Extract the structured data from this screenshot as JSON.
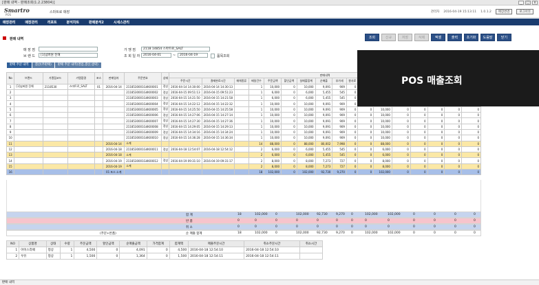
{
  "window": {
    "title": "[판매 내역 - 판매조회(1.2.23804)]",
    "controls": [
      "_",
      "□",
      "x"
    ]
  },
  "header": {
    "logo": "Smartro",
    "logo_sub": "POS",
    "shop": "스마트로 매장",
    "user": "관리자",
    "datetime": "2016-04-19 15:13:11",
    "version": "1.0.1.2",
    "btn_change": "매장변경",
    "btn_logout": "로그아웃"
  },
  "menu": [
    "매장관리",
    "매장관리",
    "리포트",
    "분석차트",
    "판매분석2",
    "시세스관리"
  ],
  "section_title": "판매 내역",
  "toolbar": [
    {
      "label": "조회",
      "enabled": true
    },
    {
      "label": "신규",
      "enabled": false
    },
    {
      "label": "저장",
      "enabled": false
    },
    {
      "label": "삭제",
      "enabled": false
    },
    {
      "label": "엑셀",
      "enabled": true
    },
    {
      "label": "출력",
      "enabled": true
    },
    {
      "label": "초기화",
      "enabled": true
    },
    {
      "label": "도움말",
      "enabled": true
    },
    {
      "label": "닫기",
      "enabled": true
    }
  ],
  "filters": {
    "store_label": "매 장 점",
    "store_value": "",
    "brand_label": "브 랜 드",
    "brand_value": "[1]넘버원 진해",
    "terminal_label": "가 맹 점",
    "terminal_value": "2118 14854 스마트로_SALT",
    "period_label": "조 회 일 자",
    "date_from": "2016-04-01",
    "date_sep": "~",
    "date_to": "2016-04-19",
    "check_label": "품목조회"
  },
  "tabs": [
    {
      "label": "판매 주문 내역",
      "active": true
    },
    {
      "label": "결산(주판매)",
      "active": false
    },
    {
      "label": "판매 주문 내역(영업,결산,생략)",
      "active": false
    }
  ],
  "overlay_text": "POS 매출조회",
  "grid": {
    "group_header": "판매내역",
    "headers": [
      "No",
      "브랜드",
      "가맹점코드",
      "가맹점명",
      "포스",
      "판매일자",
      "주문번호",
      "상태",
      "주문시간",
      "결제완료시간",
      "매체종류",
      "배달건수",
      "주문금액",
      "할인금액",
      "실매출합계",
      "순매출",
      "부가세",
      "봉사료",
      "면세금액",
      "지불금액",
      "카드",
      "현금",
      "포인트",
      "기타",
      "합계"
    ],
    "rows": [
      {
        "no": "1",
        "brand": "[1]넘버원 진해",
        "code": "2118530",
        "name": "스마트로_SALT",
        "pos": "01",
        "date": "2016-04-14",
        "order": "2118530001G4K00001",
        "status": "정상",
        "t1": "2016-04-14 14:30:00",
        "t2": "2016-04-14 14:30:13",
        "media": "",
        "cnt": "1",
        "amt": "10,000",
        "disc": "0",
        "sales": "10,000",
        "net": "9,091",
        "vat": "909",
        "svc": "0",
        "free": "0",
        "pay": "10,000",
        "card": "0",
        "cash": "0",
        "pt": "0",
        "etc": "0",
        "sum": "0",
        "type": "n"
      },
      {
        "no": "2",
        "brand": "",
        "code": "",
        "name": "",
        "pos": "",
        "date": "",
        "order": "2118530001G4K00002",
        "status": "정상",
        "t1": "2016-04-15 09:51:13",
        "t2": "2016-04-15 09:51:23",
        "media": "",
        "cnt": "1",
        "amt": "6,000",
        "disc": "0",
        "sales": "6,000",
        "net": "5,455",
        "vat": "545",
        "svc": "0",
        "free": "0",
        "pay": "6,000",
        "card": "0",
        "cash": "0",
        "pt": "0",
        "etc": "0",
        "sum": "0",
        "type": "n"
      },
      {
        "no": "3",
        "brand": "",
        "code": "",
        "name": "",
        "pos": "",
        "date": "",
        "order": "2118530001G4K00003",
        "status": "정상",
        "t1": "2016-04-15 14:21:50",
        "t2": "2016-04-15 14:21:58",
        "media": "",
        "cnt": "1",
        "amt": "6,000",
        "disc": "0",
        "sales": "6,000",
        "net": "5,455",
        "vat": "545",
        "svc": "0",
        "free": "0",
        "pay": "6,000",
        "card": "0",
        "cash": "0",
        "pt": "0",
        "etc": "0",
        "sum": "0",
        "type": "n"
      },
      {
        "no": "4",
        "brand": "",
        "code": "",
        "name": "",
        "pos": "",
        "date": "",
        "order": "2118530001G4K00004",
        "status": "정상",
        "t1": "2016-04-15 14:22:12",
        "t2": "2016-04-15 14:22:32",
        "media": "",
        "cnt": "1",
        "amt": "10,000",
        "disc": "0",
        "sales": "10,000",
        "net": "9,091",
        "vat": "909",
        "svc": "0",
        "free": "0",
        "pay": "10,000",
        "card": "0",
        "cash": "0",
        "pt": "0",
        "etc": "0",
        "sum": "0",
        "type": "n"
      },
      {
        "no": "5",
        "brand": "",
        "code": "",
        "name": "",
        "pos": "",
        "date": "",
        "order": "2118530001G4K00005",
        "status": "정상",
        "t1": "2016-04-15 14:25:50",
        "t2": "2016-04-15 14:25:58",
        "media": "",
        "cnt": "1",
        "amt": "10,000",
        "disc": "0",
        "sales": "10,000",
        "net": "9,091",
        "vat": "909",
        "svc": "0",
        "free": "0",
        "pay": "10,000",
        "card": "0",
        "cash": "0",
        "pt": "0",
        "etc": "0",
        "sum": "0",
        "type": "n"
      },
      {
        "no": "6",
        "brand": "",
        "code": "",
        "name": "",
        "pos": "",
        "date": "",
        "order": "2118530001G4K00006",
        "status": "정상",
        "t1": "2016-04-15 14:27:06",
        "t2": "2016-04-15 14:27:14",
        "media": "",
        "cnt": "1",
        "amt": "10,000",
        "disc": "0",
        "sales": "10,000",
        "net": "9,091",
        "vat": "909",
        "svc": "0",
        "free": "0",
        "pay": "10,000",
        "card": "0",
        "cash": "0",
        "pt": "0",
        "etc": "0",
        "sum": "0",
        "type": "n"
      },
      {
        "no": "7",
        "brand": "",
        "code": "",
        "name": "",
        "pos": "",
        "date": "",
        "order": "2118530001G4K00007",
        "status": "정상",
        "t1": "2016-04-15 14:27:30",
        "t2": "2016-04-15 14:27:36",
        "media": "",
        "cnt": "1",
        "amt": "10,000",
        "disc": "0",
        "sales": "10,000",
        "net": "9,091",
        "vat": "909",
        "svc": "0",
        "free": "0",
        "pay": "10,000",
        "card": "0",
        "cash": "0",
        "pt": "0",
        "etc": "0",
        "sum": "0",
        "type": "n"
      },
      {
        "no": "8",
        "brand": "",
        "code": "",
        "name": "",
        "pos": "",
        "date": "",
        "order": "2118530001G4K00008",
        "status": "정상",
        "t1": "2016-04-15 14:29:05",
        "t2": "2016-04-15 14:29:13",
        "media": "",
        "cnt": "1",
        "amt": "10,000",
        "disc": "0",
        "sales": "10,000",
        "net": "9,091",
        "vat": "909",
        "svc": "0",
        "free": "0",
        "pay": "10,000",
        "card": "0",
        "cash": "0",
        "pt": "0",
        "etc": "0",
        "sum": "0",
        "type": "n"
      },
      {
        "no": "9",
        "brand": "",
        "code": "",
        "name": "",
        "pos": "",
        "date": "",
        "order": "2118530001G4K00009",
        "status": "정상",
        "t1": "2016-04-15 14:34:16",
        "t2": "2016-04-15 14:34:24",
        "media": "",
        "cnt": "1",
        "amt": "10,000",
        "disc": "0",
        "sales": "10,000",
        "net": "9,091",
        "vat": "909",
        "svc": "0",
        "free": "0",
        "pay": "10,000",
        "card": "0",
        "cash": "0",
        "pt": "0",
        "etc": "0",
        "sum": "0",
        "type": "n"
      },
      {
        "no": "10",
        "brand": "",
        "code": "",
        "name": "",
        "pos": "",
        "date": "",
        "order": "2118530001G4K00010",
        "status": "정상",
        "t1": "2016-04-15 14:36:28",
        "t2": "2016-04-15 14:36:34",
        "media": "",
        "cnt": "1",
        "amt": "10,000",
        "disc": "0",
        "sales": "10,000",
        "net": "9,091",
        "vat": "909",
        "svc": "0",
        "free": "0",
        "pay": "10,000",
        "card": "0",
        "cash": "0",
        "pt": "0",
        "etc": "0",
        "sum": "0",
        "type": "n"
      },
      {
        "no": "11",
        "brand": "",
        "code": "",
        "name": "",
        "pos": "",
        "date": "2016-04-14",
        "order": "소계",
        "status": "",
        "t1": "",
        "t2": "",
        "media": "",
        "cnt": "14",
        "amt": "88,000",
        "disc": "0",
        "sales": "88,000",
        "net": "80,002",
        "vat": "7,998",
        "svc": "0",
        "free": "0",
        "pay": "88,000",
        "card": "0",
        "cash": "0",
        "pt": "0",
        "etc": "0",
        "sum": "0",
        "type": "sub"
      },
      {
        "no": "12",
        "brand": "",
        "code": "",
        "name": "",
        "pos": "",
        "date": "2016-04-18",
        "order": "2118530001G4K00011",
        "status": "정상",
        "t1": "2016-04-18 12:54:07",
        "t2": "2016-04-18 12:54:12",
        "media": "",
        "cnt": "2",
        "amt": "6,000",
        "disc": "0",
        "sales": "6,000",
        "net": "5,455",
        "vat": "545",
        "svc": "0",
        "free": "0",
        "pay": "6,000",
        "card": "0",
        "cash": "0",
        "pt": "0",
        "etc": "0",
        "sum": "0",
        "type": "n"
      },
      {
        "no": "13",
        "brand": "",
        "code": "",
        "name": "",
        "pos": "",
        "date": "2016-04-18",
        "order": "소계",
        "status": "",
        "t1": "",
        "t2": "",
        "media": "",
        "cnt": "2",
        "amt": "6,000",
        "disc": "0",
        "sales": "6,000",
        "net": "5,455",
        "vat": "545",
        "svc": "0",
        "free": "0",
        "pay": "6,000",
        "card": "0",
        "cash": "0",
        "pt": "0",
        "etc": "0",
        "sum": "0",
        "type": "sub"
      },
      {
        "no": "14",
        "brand": "",
        "code": "",
        "name": "",
        "pos": "",
        "date": "2016-04-19",
        "order": "2118530001G4K00012",
        "status": "정상",
        "t1": "2016-04-19 09:31:10",
        "t2": "2016-04-19 09:31:17",
        "media": "",
        "cnt": "2",
        "amt": "8,000",
        "disc": "0",
        "sales": "8,000",
        "net": "7,273",
        "vat": "727",
        "svc": "0",
        "free": "0",
        "pay": "8,000",
        "card": "0",
        "cash": "0",
        "pt": "0",
        "etc": "0",
        "sum": "0",
        "type": "n"
      },
      {
        "no": "15",
        "brand": "",
        "code": "",
        "name": "",
        "pos": "",
        "date": "2016-04-19",
        "order": "소계",
        "status": "",
        "t1": "",
        "t2": "",
        "media": "",
        "cnt": "2",
        "amt": "8,000",
        "disc": "0",
        "sales": "8,000",
        "net": "7,273",
        "vat": "727",
        "svc": "0",
        "free": "0",
        "pay": "8,000",
        "card": "0",
        "cash": "0",
        "pt": "0",
        "etc": "0",
        "sum": "0",
        "type": "sub"
      },
      {
        "no": "16",
        "brand": "",
        "code": "",
        "name": "",
        "pos": "",
        "date": "01 포스 소계",
        "order": "",
        "status": "",
        "t1": "",
        "t2": "",
        "media": "",
        "cnt": "18",
        "amt": "102,000",
        "disc": "0",
        "sales": "102,000",
        "net": "92,730",
        "vat": "9,270",
        "svc": "0",
        "free": "0",
        "pay": "102,000",
        "card": "0",
        "cash": "0",
        "pt": "0",
        "etc": "0",
        "sum": "0",
        "type": "tot"
      }
    ]
  },
  "summary": [
    {
      "label": "합 계",
      "cnt": "18",
      "amt": "102,000",
      "disc": "0",
      "sales": "102,000",
      "net": "92,730",
      "vat": "9,270",
      "svc": "0",
      "pay": "102,000",
      "card": "102,000",
      "cash": "0",
      "pt": "0",
      "etc": "0",
      "sum": "0"
    },
    {
      "label": "반 품",
      "cnt": "0",
      "amt": "0",
      "disc": "0",
      "sales": "0",
      "net": "0",
      "vat": "0",
      "svc": "0",
      "pay": "0",
      "card": "0",
      "cash": "0",
      "pt": "0",
      "etc": "0",
      "sum": "0"
    },
    {
      "label": "취 소",
      "cnt": "0",
      "amt": "0",
      "disc": "0",
      "sales": "0",
      "net": "0",
      "vat": "0",
      "svc": "0",
      "pay": "0",
      "card": "0",
      "cash": "0",
      "pt": "0",
      "etc": "0",
      "sum": "0"
    },
    {
      "label": "순 매출 합계",
      "cnt": "18",
      "amt": "102,000",
      "disc": "0",
      "sales": "102,000",
      "net": "92,730",
      "vat": "9,270",
      "svc": "0",
      "pay": "102,000",
      "card": "102,000",
      "cash": "0",
      "pt": "0",
      "etc": "0",
      "sum": "0",
      "note": "(주문+반품)"
    }
  ],
  "lower": {
    "headers": [
      "NO",
      "상품명",
      "상태",
      "수량",
      "주문금액",
      "할인금액",
      "순매출금액",
      "가격합계",
      "합계액",
      "매출주문시간",
      "취소주문시간",
      "취소시간"
    ],
    "rows": [
      [
        "1",
        "아이스라떼",
        "정상",
        "1",
        "4,500",
        "0",
        "4,091",
        "0",
        "4,500",
        "2016-04-18 12:54:10",
        "2016-04-18 12:54:10",
        ""
      ],
      [
        "2",
        "우유",
        "정상",
        "1",
        "1,500",
        "0",
        "1,364",
        "0",
        "1,500",
        "2016-04-18 12:54:11",
        "2016-04-18 12:54:11",
        ""
      ]
    ]
  },
  "status": "판매 내역"
}
